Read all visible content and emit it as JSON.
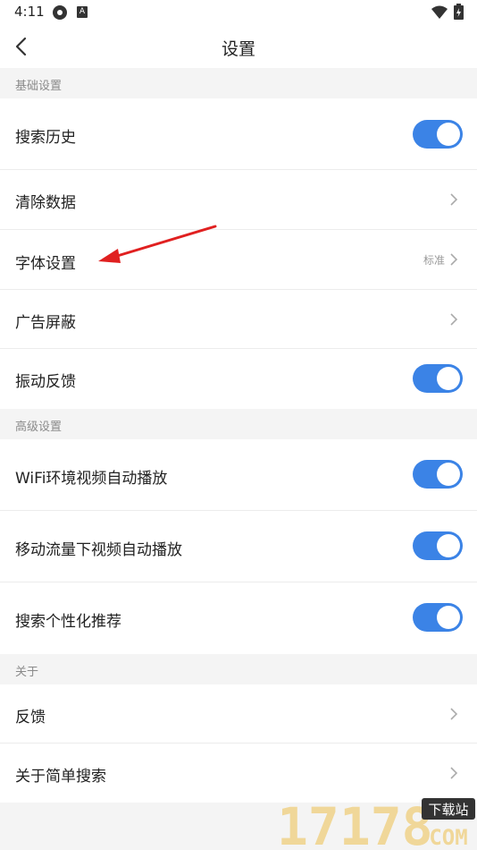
{
  "status_bar": {
    "time": "4:11",
    "notification_badge": "A"
  },
  "nav": {
    "title": "设置"
  },
  "sections": {
    "basic": {
      "title": "基础设置",
      "items": [
        {
          "label": "搜索历史",
          "control": "toggle",
          "on": true
        },
        {
          "label": "清除数据",
          "control": "chevron"
        },
        {
          "label": "字体设置",
          "control": "chevron",
          "value": "标准"
        },
        {
          "label": "广告屏蔽",
          "control": "chevron"
        },
        {
          "label": "振动反馈",
          "control": "toggle",
          "on": true
        }
      ]
    },
    "advanced": {
      "title": "高级设置",
      "items": [
        {
          "label": "WiFi环境视频自动播放",
          "control": "toggle",
          "on": true
        },
        {
          "label": "移动流量下视频自动播放",
          "control": "toggle",
          "on": true
        },
        {
          "label": "搜索个性化推荐",
          "control": "toggle",
          "on": true
        }
      ]
    },
    "about": {
      "title": "关于",
      "items": [
        {
          "label": "反馈",
          "control": "chevron"
        },
        {
          "label": "关于简单搜索",
          "control": "chevron"
        }
      ]
    }
  },
  "watermark": {
    "digits": "17178",
    "badge": "下载站",
    "suffix": "COM"
  },
  "colors": {
    "accent": "#3b83e6",
    "arrow": "#e02020",
    "watermark_gold": "#f0d38a"
  }
}
